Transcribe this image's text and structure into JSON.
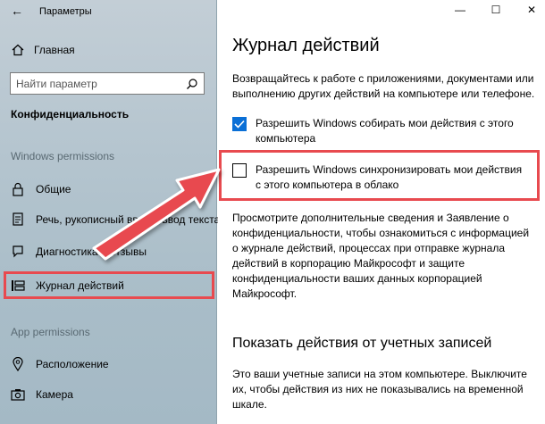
{
  "window": {
    "app_title": "Параметры",
    "back_glyph": "←",
    "minimize_glyph": "—",
    "maximize_glyph": "☐",
    "close_glyph": "✕"
  },
  "sidebar": {
    "home_label": "Главная",
    "search_placeholder": "Найти параметр",
    "section_title": "Конфиденциальность",
    "group1_label": "Windows permissions",
    "items": [
      {
        "label": "Общие",
        "icon": "lock-icon"
      },
      {
        "label": "Речь, рукописный ввод и ввод текста",
        "icon": "speech-icon"
      },
      {
        "label": "Диагностика и отзывы",
        "icon": "feedback-icon"
      },
      {
        "label": "Журнал действий",
        "icon": "timeline-icon",
        "selected": true
      }
    ],
    "group2_label": "App permissions",
    "items2": [
      {
        "label": "Расположение",
        "icon": "location-icon"
      },
      {
        "label": "Камера",
        "icon": "camera-icon"
      }
    ]
  },
  "main": {
    "title": "Журнал действий",
    "intro": "Возвращайтесь к работе с приложениями, документами или выполнению других действий на компьютере или телефоне.",
    "checkbox1": {
      "label": "Разрешить Windows собирать мои действия с этого компьютера",
      "checked": true
    },
    "checkbox2": {
      "label": "Разрешить Windows синхронизировать мои действия с этого компьютера в облако",
      "checked": false
    },
    "info": "Просмотрите дополнительные сведения и Заявление о конфиденциальности, чтобы ознакомиться с информацией о журнале действий, процессах при отправке журнала действий в корпорацию Майкрософт и защите конфиденциальности ваших данных корпорацией Майкрософт.",
    "subheading": "Показать действия от учетных записей",
    "info2": "Это ваши учетные записи на этом компьютере. Выключите их, чтобы действия из них не показывались на временной шкале."
  },
  "colors": {
    "accent": "#0a6fd6",
    "highlight": "#e84a4f"
  }
}
